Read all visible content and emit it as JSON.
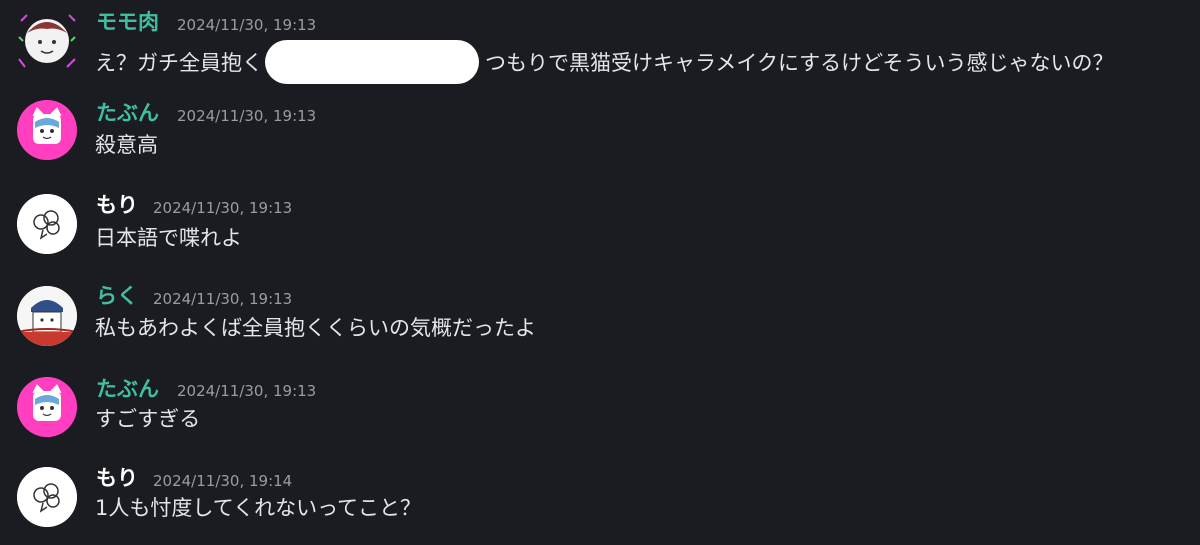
{
  "messages": [
    {
      "author": "モモ肉",
      "author_color": "#3fbfa2",
      "timestamp": "2024/11/30, 19:13",
      "text_before": "え？ガチ全員抱く",
      "text_after": "つもりで黒猫受けキャラメイクにするけどそういう感じゃないの？",
      "avatar": "momoniku-avatar"
    },
    {
      "author": "たぶん",
      "author_color": "#3fbfa2",
      "timestamp": "2024/11/30, 19:13",
      "text": "殺意高",
      "avatar": "tabun-avatar"
    },
    {
      "author": "もり",
      "author_color": "#ffffff",
      "timestamp": "2024/11/30, 19:13",
      "text": "日本語で喋れよ",
      "avatar": "mori-avatar"
    },
    {
      "author": "らく",
      "author_color": "#3fbfa2",
      "timestamp": "2024/11/30, 19:13",
      "text": "私もあわよくば全員抱くくらいの気概だったよ",
      "avatar": "raku-avatar"
    },
    {
      "author": "たぶん",
      "author_color": "#3fbfa2",
      "timestamp": "2024/11/30, 19:13",
      "text": "すごすぎる",
      "avatar": "tabun-avatar"
    },
    {
      "author": "もり",
      "author_color": "#ffffff",
      "timestamp": "2024/11/30, 19:14",
      "text": "1人も忖度してくれないってこと？",
      "avatar": "mori-avatar"
    }
  ],
  "colors": {
    "background": "#1b1c21",
    "message_text": "#e4e5e8",
    "timestamp": "#9a9ca5",
    "role_teal": "#3fbfa2",
    "tabun_avatar_bg": "#ff3fbf"
  }
}
